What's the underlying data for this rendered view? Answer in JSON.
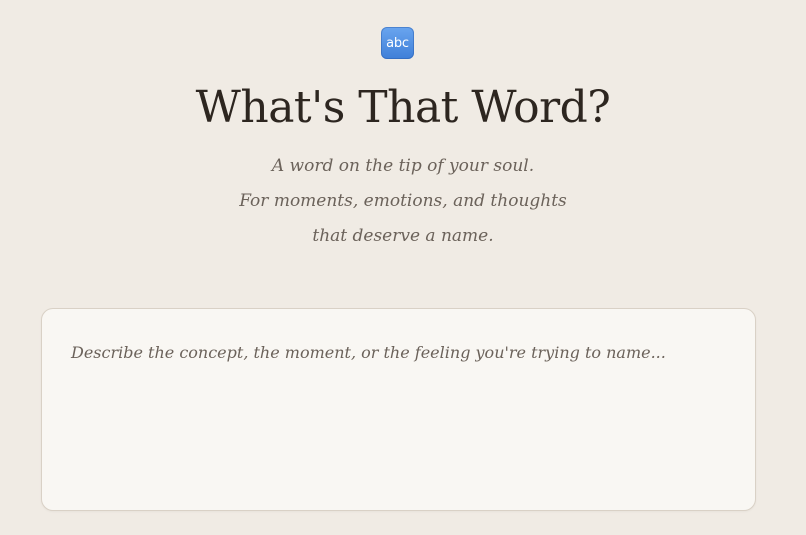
{
  "logo": {
    "text": "abc",
    "icon": "abc-icon",
    "color_top": "#6aa5ef",
    "color_bottom": "#3f7fd8"
  },
  "header": {
    "title": "What's That Word?",
    "subtitle_lines": [
      "A word on the tip of your soul.",
      "For moments, emotions, and thoughts",
      "that deserve a name."
    ]
  },
  "input": {
    "value": "",
    "placeholder": "Describe the concept, the moment, or the feeling you're trying to name..."
  },
  "colors": {
    "background": "#f0ebe4",
    "card_background": "#f9f7f3",
    "title_text": "#2d2620",
    "muted_text": "#6b625a"
  }
}
